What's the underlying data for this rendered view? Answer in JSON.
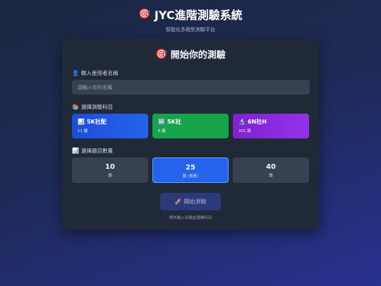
{
  "header": {
    "icon": "target-icon",
    "title": "JYC進階測驗系統",
    "subtitle": "智能化多題型測驗平台"
  },
  "card": {
    "title": "開始你的測驗",
    "name_section": {
      "label": "輸入使用者名稱",
      "placeholder": "請輸入你的名稱",
      "value": ""
    },
    "subject_section": {
      "label": "選擇測驗科目",
      "subjects": [
        {
          "label": "5K社配",
          "count": "11 題",
          "color": "#2563eb",
          "icon": "chart-icon"
        },
        {
          "label": "5K社",
          "count": "6 題",
          "color": "#16a34a",
          "icon": "abc-icon"
        },
        {
          "label": "6N社H",
          "count": "301 題",
          "color": "#9333ea",
          "icon": "microscope-icon"
        }
      ]
    },
    "count_section": {
      "label": "選擇題目數量",
      "options": [
        {
          "num": "10",
          "unit": "題",
          "selected": false
        },
        {
          "num": "25",
          "unit": "題 (推薦)",
          "selected": true
        },
        {
          "num": "40",
          "unit": "題",
          "selected": false
        }
      ]
    },
    "start_button": "開始測驗",
    "hint": "請先輸入名稱並選擇科目"
  }
}
